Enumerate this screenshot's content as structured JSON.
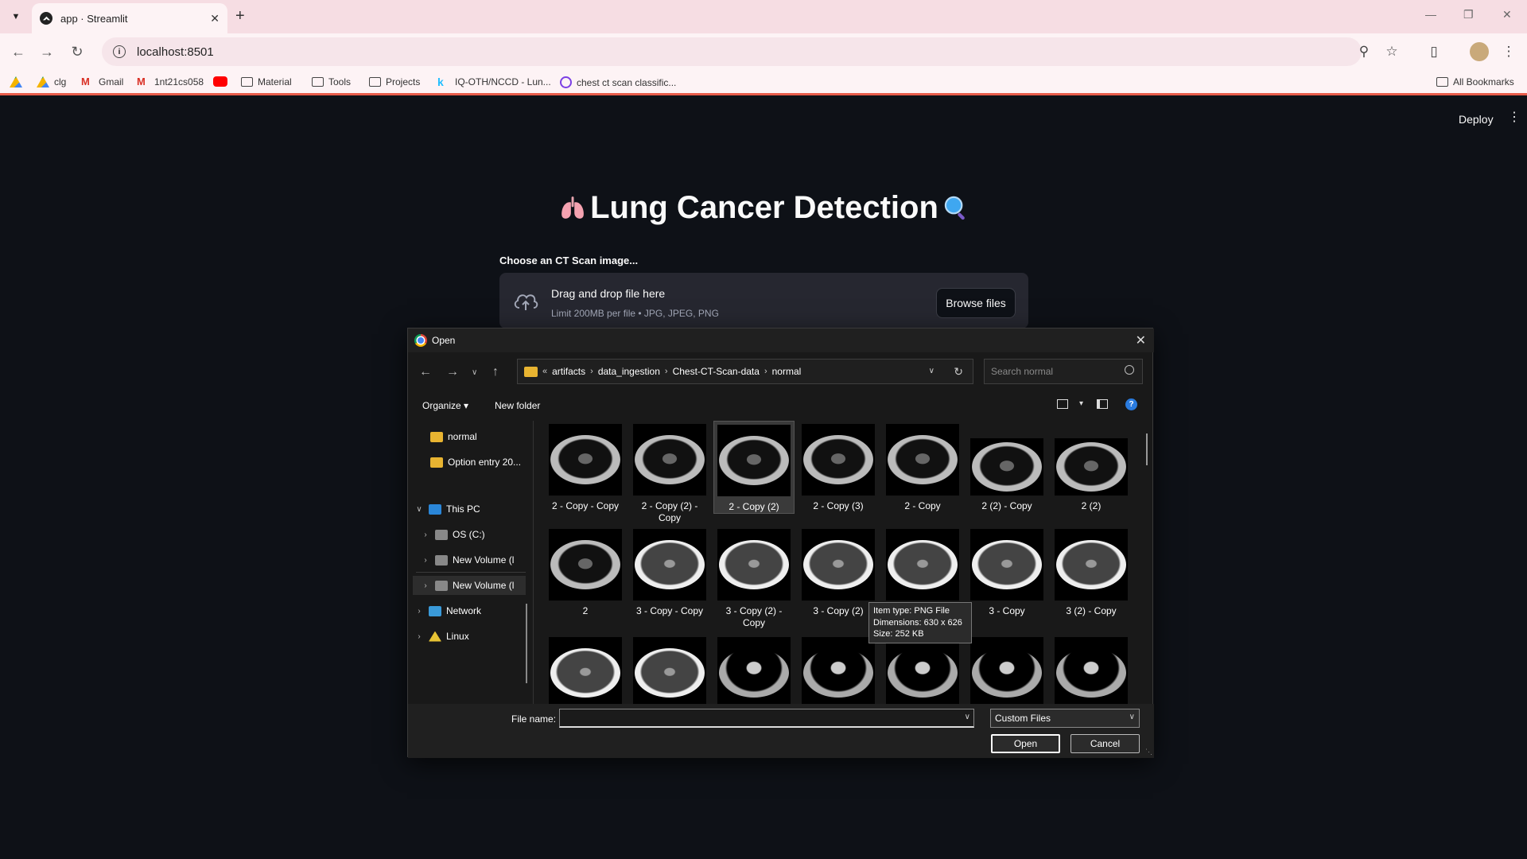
{
  "browser": {
    "tab_title": "app · Streamlit",
    "url": "localhost:8501",
    "bookmarks": [
      {
        "label": "",
        "icon": "google-drive-icon"
      },
      {
        "label": "clg",
        "icon": "google-drive-icon"
      },
      {
        "label": "Gmail",
        "icon": "gmail-icon"
      },
      {
        "label": "1nt21cs058",
        "icon": "gmail-icon"
      },
      {
        "label": "",
        "icon": "youtube-icon"
      },
      {
        "label": "Material",
        "icon": "folder-icon"
      },
      {
        "label": "Tools",
        "icon": "folder-icon"
      },
      {
        "label": "Projects",
        "icon": "folder-icon"
      },
      {
        "label": "IQ-OTH/NCCD - Lun...",
        "icon": "kaggle-icon"
      },
      {
        "label": "chest ct scan classific...",
        "icon": "site-icon"
      }
    ],
    "all_bookmarks": "All Bookmarks"
  },
  "app": {
    "deploy": "Deploy",
    "title": "Lung Cancer Detection",
    "uploader_label": "Choose an CT Scan image...",
    "dropzone_title": "Drag and drop file here",
    "dropzone_sub": "Limit 200MB per file • JPG, JPEG, PNG",
    "browse": "Browse files"
  },
  "dialog": {
    "title": "Open",
    "breadcrumb": [
      "artifacts",
      "data_ingestion",
      "Chest-CT-Scan-data",
      "normal"
    ],
    "search_placeholder": "Search normal",
    "organize": "Organize",
    "new_folder": "New folder",
    "nav": [
      "normal",
      "Option entry 20...",
      "This PC",
      "OS (C:)",
      "New Volume (l",
      "New Volume (l",
      "Network",
      "Linux"
    ],
    "files": [
      "2 - Copy - Copy",
      "2 - Copy (2) - Copy",
      "2 - Copy (2)",
      "2 - Copy (3)",
      "2 - Copy",
      "2 (2) - Copy",
      "2 (2)",
      "2",
      "3 - Copy - Copy",
      "3 - Copy (2) - Copy",
      "3 - Copy (2)",
      "3 - Copy (3)",
      "3 - Copy",
      "3 (2) - Copy",
      "",
      "",
      "",
      "",
      "",
      "",
      ""
    ],
    "tooltip": [
      "Item type: PNG File",
      "Dimensions: 630 x 626",
      "Size: 252 KB"
    ],
    "file_name_label": "File name:",
    "file_name_value": "",
    "file_type": "Custom Files",
    "open": "Open",
    "cancel": "Cancel"
  }
}
